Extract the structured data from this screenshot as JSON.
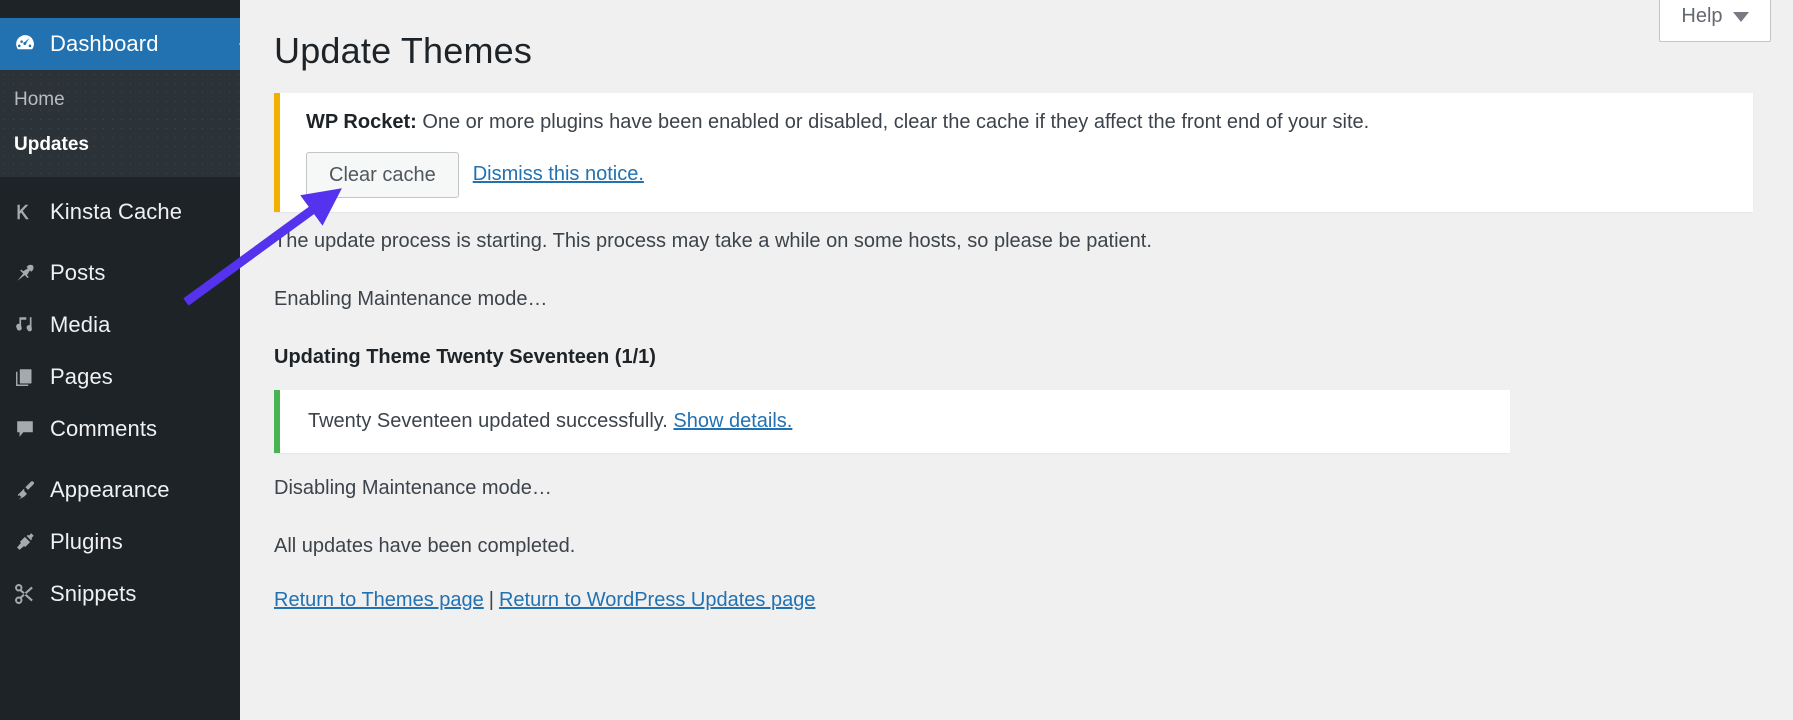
{
  "sidebar": {
    "items": [
      {
        "id": "dashboard",
        "label": "Dashboard",
        "icon": "dashboard-icon",
        "current": true
      },
      {
        "id": "kinsta-cache",
        "label": "Kinsta Cache",
        "icon": "kinsta-k-icon",
        "current": false
      },
      {
        "id": "posts",
        "label": "Posts",
        "icon": "pin-icon",
        "current": false
      },
      {
        "id": "media",
        "label": "Media",
        "icon": "media-icon",
        "current": false
      },
      {
        "id": "pages",
        "label": "Pages",
        "icon": "pages-icon",
        "current": false
      },
      {
        "id": "comments",
        "label": "Comments",
        "icon": "comment-bubble-icon",
        "current": false
      },
      {
        "id": "appearance",
        "label": "Appearance",
        "icon": "paintbrush-icon",
        "current": false
      },
      {
        "id": "plugins",
        "label": "Plugins",
        "icon": "plug-icon",
        "current": false
      },
      {
        "id": "snippets",
        "label": "Snippets",
        "icon": "scissors-icon",
        "current": false
      }
    ],
    "submenu": [
      {
        "id": "home",
        "label": "Home",
        "current": false
      },
      {
        "id": "updates",
        "label": "Updates",
        "current": true
      }
    ]
  },
  "help_tab": {
    "label": "Help"
  },
  "page": {
    "title": "Update Themes"
  },
  "wp_rocket_notice": {
    "plugin_name": "WP Rocket:",
    "message": " One or more plugins have been enabled or disabled, clear the cache if they affect the front end of your site.",
    "clear_cache_label": "Clear cache",
    "dismiss_label": "Dismiss this notice.",
    "accent_color": "#f0b100"
  },
  "update_log": {
    "starting": "The update process is starting. This process may take a while on some hosts, so please be patient.",
    "enabling_maintenance": "Enabling Maintenance mode…",
    "updating_theme": "Updating Theme Twenty Seventeen (1/1)",
    "success_message": "Twenty Seventeen updated successfully. ",
    "show_details_label": "Show details.",
    "success_color": "#46b450",
    "disabling_maintenance": "Disabling Maintenance mode…",
    "all_completed": "All updates have been completed."
  },
  "footer_links": {
    "themes_page": "Return to Themes page",
    "separator": "|",
    "wp_updates_page": "Return to WordPress Updates page"
  },
  "annotation": {
    "arrow_color": "#5533ee"
  }
}
